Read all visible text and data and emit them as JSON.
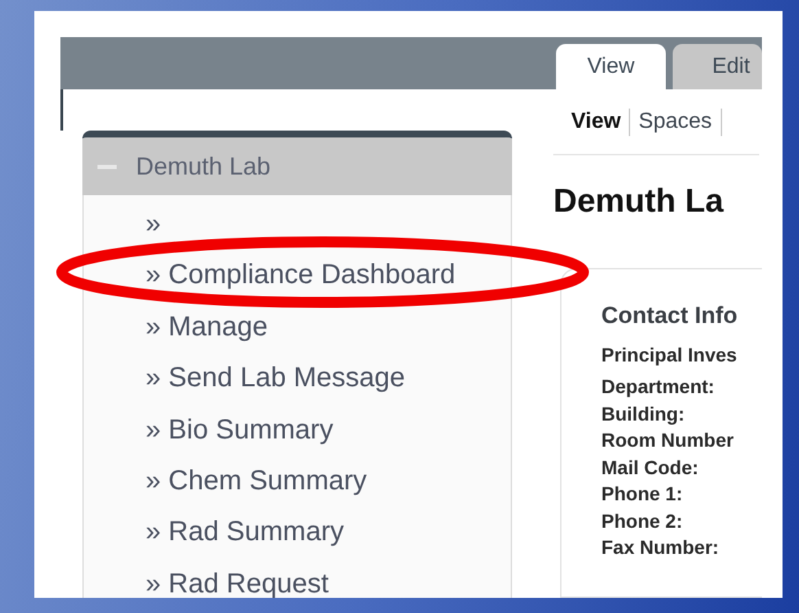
{
  "tabs": [
    {
      "label": "View",
      "selected": true
    },
    {
      "label": "Edit",
      "selected": false
    }
  ],
  "sidebar": {
    "title": "Demuth Lab",
    "expanded": true,
    "items": [
      {
        "label": "»"
      },
      {
        "label": "» Compliance Dashboard"
      },
      {
        "label": "» Manage"
      },
      {
        "label": "» Send Lab Message"
      },
      {
        "label": "» Bio Summary"
      },
      {
        "label": "» Chem Summary"
      },
      {
        "label": "» Rad Summary"
      },
      {
        "label": "» Rad Request"
      }
    ]
  },
  "subnav": [
    {
      "label": "View",
      "selected": true
    },
    {
      "label": "Spaces",
      "selected": false
    }
  ],
  "page_title": "Demuth La",
  "contact_card": {
    "title": "Contact Info",
    "pi_label": "Principal Inves",
    "fields": [
      "Department:",
      "Building:",
      "Room Number",
      "Mail Code:",
      "Phone 1:",
      "Phone 2:",
      "Fax Number:"
    ]
  }
}
